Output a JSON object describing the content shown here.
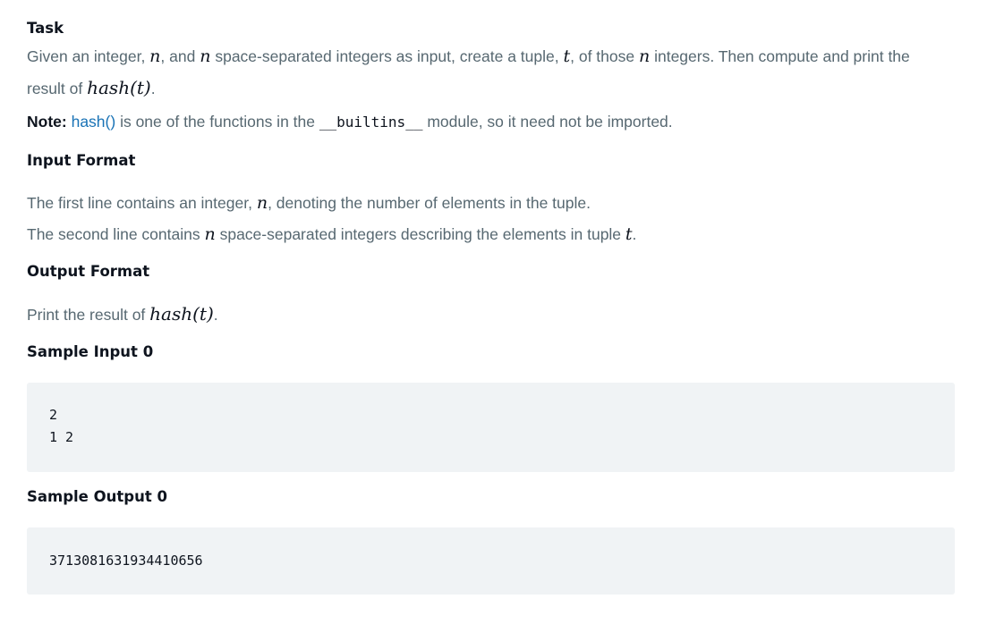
{
  "task": {
    "heading": "Task",
    "line1_p1": "Given an integer, ",
    "var_n": "n",
    "line1_p2": ", and ",
    "line1_p3": " space-separated integers as input, create a tuple, ",
    "var_t": "t",
    "line1_p4": ", of those ",
    "line1_p5": " integers. Then compute and print the",
    "line2_p1": "result of ",
    "hash_expr": "hash(t)",
    "line2_p2": ".",
    "note_label": "Note:",
    "note_link": "hash()",
    "note_p1": " is one of the functions in the ",
    "note_code": "__builtins__",
    "note_p2": " module, so it need not be imported."
  },
  "input_format": {
    "heading": "Input Format",
    "line1_p1": "The first line contains an integer, ",
    "line1_p2": ", denoting the number of elements in the tuple.",
    "line2_p1": "The second line contains ",
    "line2_p2": " space-separated integers describing the elements in tuple ",
    "line2_p3": "."
  },
  "output_format": {
    "heading": "Output Format",
    "line1_p1": "Print the result of ",
    "line1_p2": "."
  },
  "sample_input": {
    "heading": "Sample Input 0",
    "lines": [
      "2",
      "1 2"
    ]
  },
  "sample_output": {
    "heading": "Sample Output 0",
    "lines": [
      "3713081631934410656"
    ]
  }
}
